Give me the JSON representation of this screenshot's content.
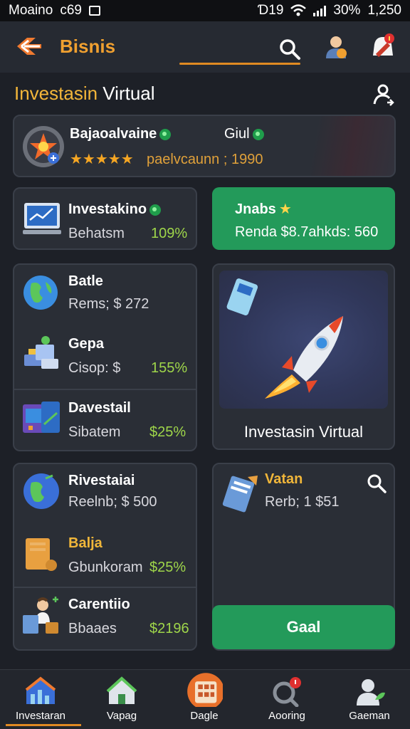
{
  "status_bar": {
    "carrier": "Moaino",
    "code": "c69",
    "battery": "30%",
    "time": "1,250",
    "signal_text": "Ɗ19"
  },
  "header": {
    "title": "Bisnis",
    "icons": [
      "back-arrow-icon",
      "search-icon",
      "avatar-icon",
      "bell-icon"
    ]
  },
  "section": {
    "title_highlight": "Investasin",
    "title_rest": " Virtual"
  },
  "hero": {
    "name": "Bajaoalvaine",
    "right_label": "Giul",
    "stars": "★★★★★",
    "sub": "paelvcaunn ; 1990"
  },
  "tile_invest": {
    "title": "Investakino",
    "sub": "Behatsm",
    "value": "109%"
  },
  "tile_green": {
    "title": "Jnabs",
    "text": "Renda $8.7ahkds: 560"
  },
  "list1": [
    {
      "title": "Batle",
      "sub": "Rems; $ 272",
      "value": ""
    },
    {
      "title": "Gepa",
      "sub": "Cisop: $",
      "value": "155%"
    },
    {
      "title": "Davestail",
      "sub": "Sibatem",
      "value": "$25%"
    }
  ],
  "rocket_card": {
    "caption": "Investasin Virtual"
  },
  "list2": [
    {
      "title": "Rivestaiai",
      "sub": "Reelnb; $ 500",
      "value": ""
    },
    {
      "title": "Balja",
      "sub": "Gbunkoram",
      "value": "$25%"
    },
    {
      "title": "Carentiio",
      "sub": "Bbaaes",
      "value": "$2196"
    }
  ],
  "right_card": {
    "title": "Vatan",
    "sub": "Rerb; 1 $51",
    "button": "Gaal"
  },
  "bottom_nav": [
    {
      "label": "Investaran",
      "icon": "house-chart-icon",
      "active": true
    },
    {
      "label": "Vapag",
      "icon": "home-icon",
      "active": false
    },
    {
      "label": "Dagle",
      "icon": "building-icon",
      "active": false
    },
    {
      "label": "Aooring",
      "icon": "search-notification-icon",
      "active": false
    },
    {
      "label": "Gaeman",
      "icon": "profile-icon",
      "active": false
    }
  ],
  "colors": {
    "accent": "#f0a030",
    "green": "#239a5a",
    "value_green": "#9fd64a",
    "bg": "#1d2027"
  }
}
